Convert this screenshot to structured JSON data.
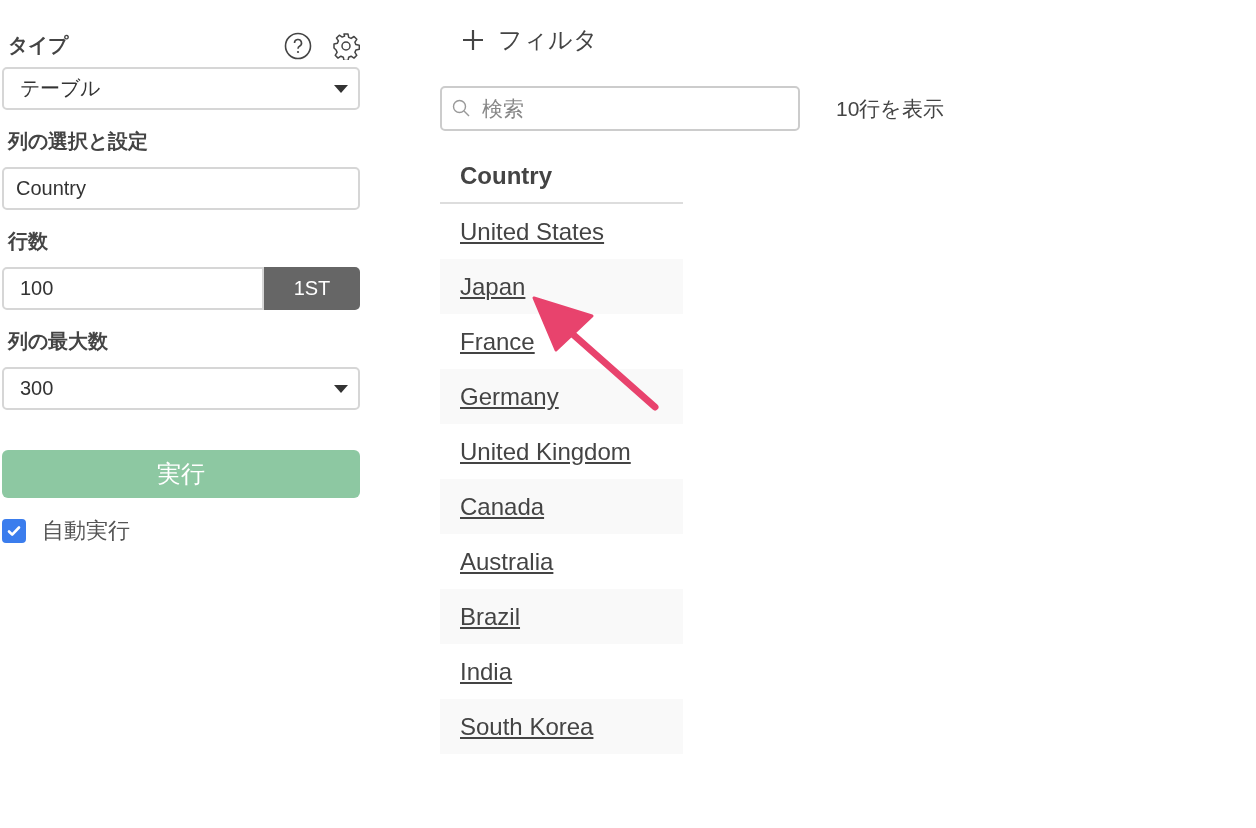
{
  "settings": {
    "type": {
      "label": "タイプ",
      "value": "テーブル"
    },
    "columns": {
      "label": "列の選択と設定",
      "value": "Country"
    },
    "rows": {
      "label": "行数",
      "value": "100",
      "button": "1ST"
    },
    "max_columns": {
      "label": "列の最大数",
      "value": "300"
    },
    "run_button": {
      "label": "実行",
      "disabled": true
    },
    "auto_run": {
      "label": "自動実行",
      "checked": true
    }
  },
  "results": {
    "add_filter": "フィルタ",
    "search": {
      "placeholder": "検索"
    },
    "row_count": "10行を表示",
    "table": {
      "columns": [
        "Country"
      ],
      "rows": [
        [
          "United States"
        ],
        [
          "Japan"
        ],
        [
          "France"
        ],
        [
          "Germany"
        ],
        [
          "United Kingdom"
        ],
        [
          "Canada"
        ],
        [
          "Australia"
        ],
        [
          "Brazil"
        ],
        [
          "India"
        ],
        [
          "South Korea"
        ]
      ]
    }
  }
}
